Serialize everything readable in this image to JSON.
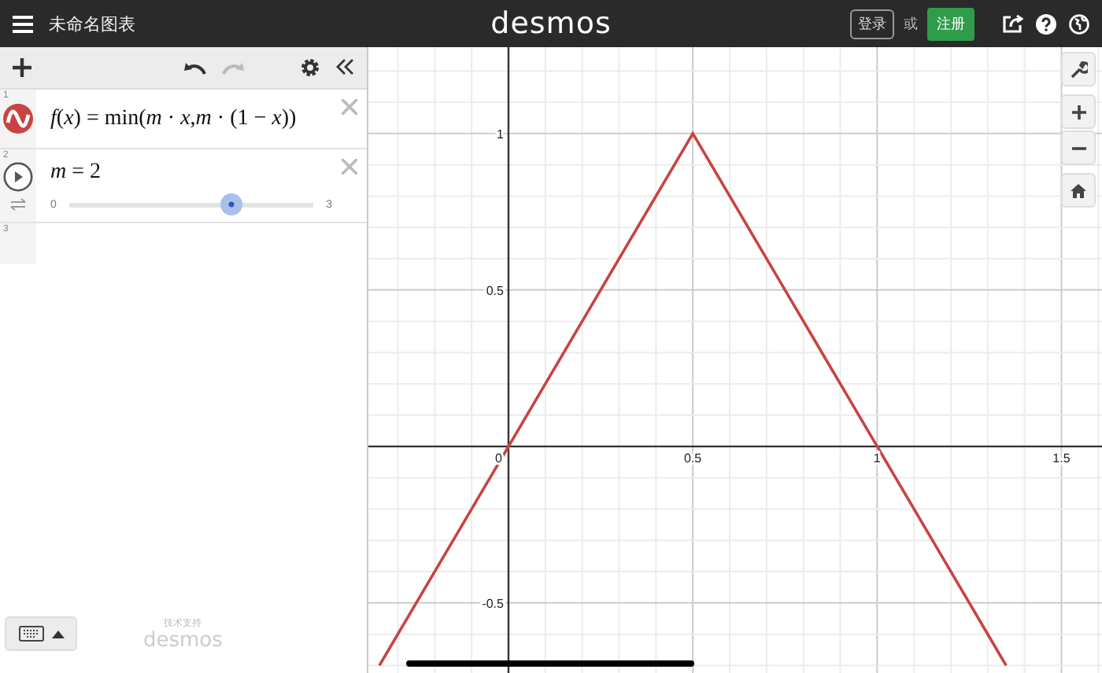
{
  "header": {
    "title": "未命名图表",
    "logo": "desmos",
    "login": "登录",
    "or": "或",
    "signup": "注册"
  },
  "expressions": [
    {
      "kind": "function",
      "index": "1",
      "latex": "*f*(*x*) = min(*m* · *x*,*m* · (1 − *x*))",
      "color": "#c74440"
    },
    {
      "kind": "slider",
      "index": "2",
      "latex": "*m* = 2",
      "min": "0",
      "max": "3",
      "level": 0.667
    },
    {
      "kind": "empty",
      "index": "3"
    }
  ],
  "footer": {
    "powered_by": "技术支持",
    "logo": "desmos"
  },
  "graph": {
    "chart_data": {
      "type": "line",
      "grid": true,
      "x": [
        -0.35,
        0,
        0.5,
        1,
        1.35
      ],
      "series": [
        {
          "color": "#c74440",
          "values": [
            -0.7,
            0,
            1,
            0,
            -0.7
          ]
        }
      ],
      "xlim": [
        -0.38,
        1.61
      ],
      "ylim": [
        -0.724,
        1.276
      ],
      "xticks": [
        0,
        0.5,
        1,
        1.5
      ],
      "yticks": [
        -0.5,
        0.5,
        1
      ]
    }
  }
}
